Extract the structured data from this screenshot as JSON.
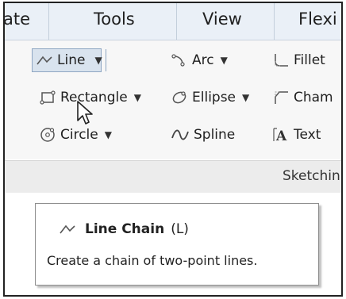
{
  "menubar": {
    "items": [
      "ate",
      "Tools",
      "View",
      "Flexi"
    ]
  },
  "ribbon": {
    "line": {
      "label": "Line",
      "icon": "line-chain-icon"
    },
    "rectangle": {
      "label": "Rectangle",
      "icon": "rectangle-icon"
    },
    "circle": {
      "label": "Circle",
      "icon": "circle-icon"
    },
    "arc": {
      "label": "Arc",
      "icon": "arc-icon"
    },
    "ellipse": {
      "label": "Ellipse",
      "icon": "ellipse-icon"
    },
    "spline": {
      "label": "Spline",
      "icon": "spline-icon"
    },
    "fillet": {
      "label": "Fillet",
      "icon": "fillet-icon"
    },
    "chamfer": {
      "label": "Cham",
      "icon": "chamfer-icon"
    },
    "text": {
      "label": "Text",
      "icon": "text-icon"
    },
    "group_label": "Sketchin"
  },
  "tooltip": {
    "title": "Line Chain",
    "shortcut": "(L)",
    "description": "Create a chain of two-point lines."
  },
  "colors": {
    "menubar_bg": "#eaf0f7",
    "selected_button_bg": "#d9e3ee",
    "selected_button_border": "#8ea6c2",
    "group_bar_bg": "#ececec"
  }
}
